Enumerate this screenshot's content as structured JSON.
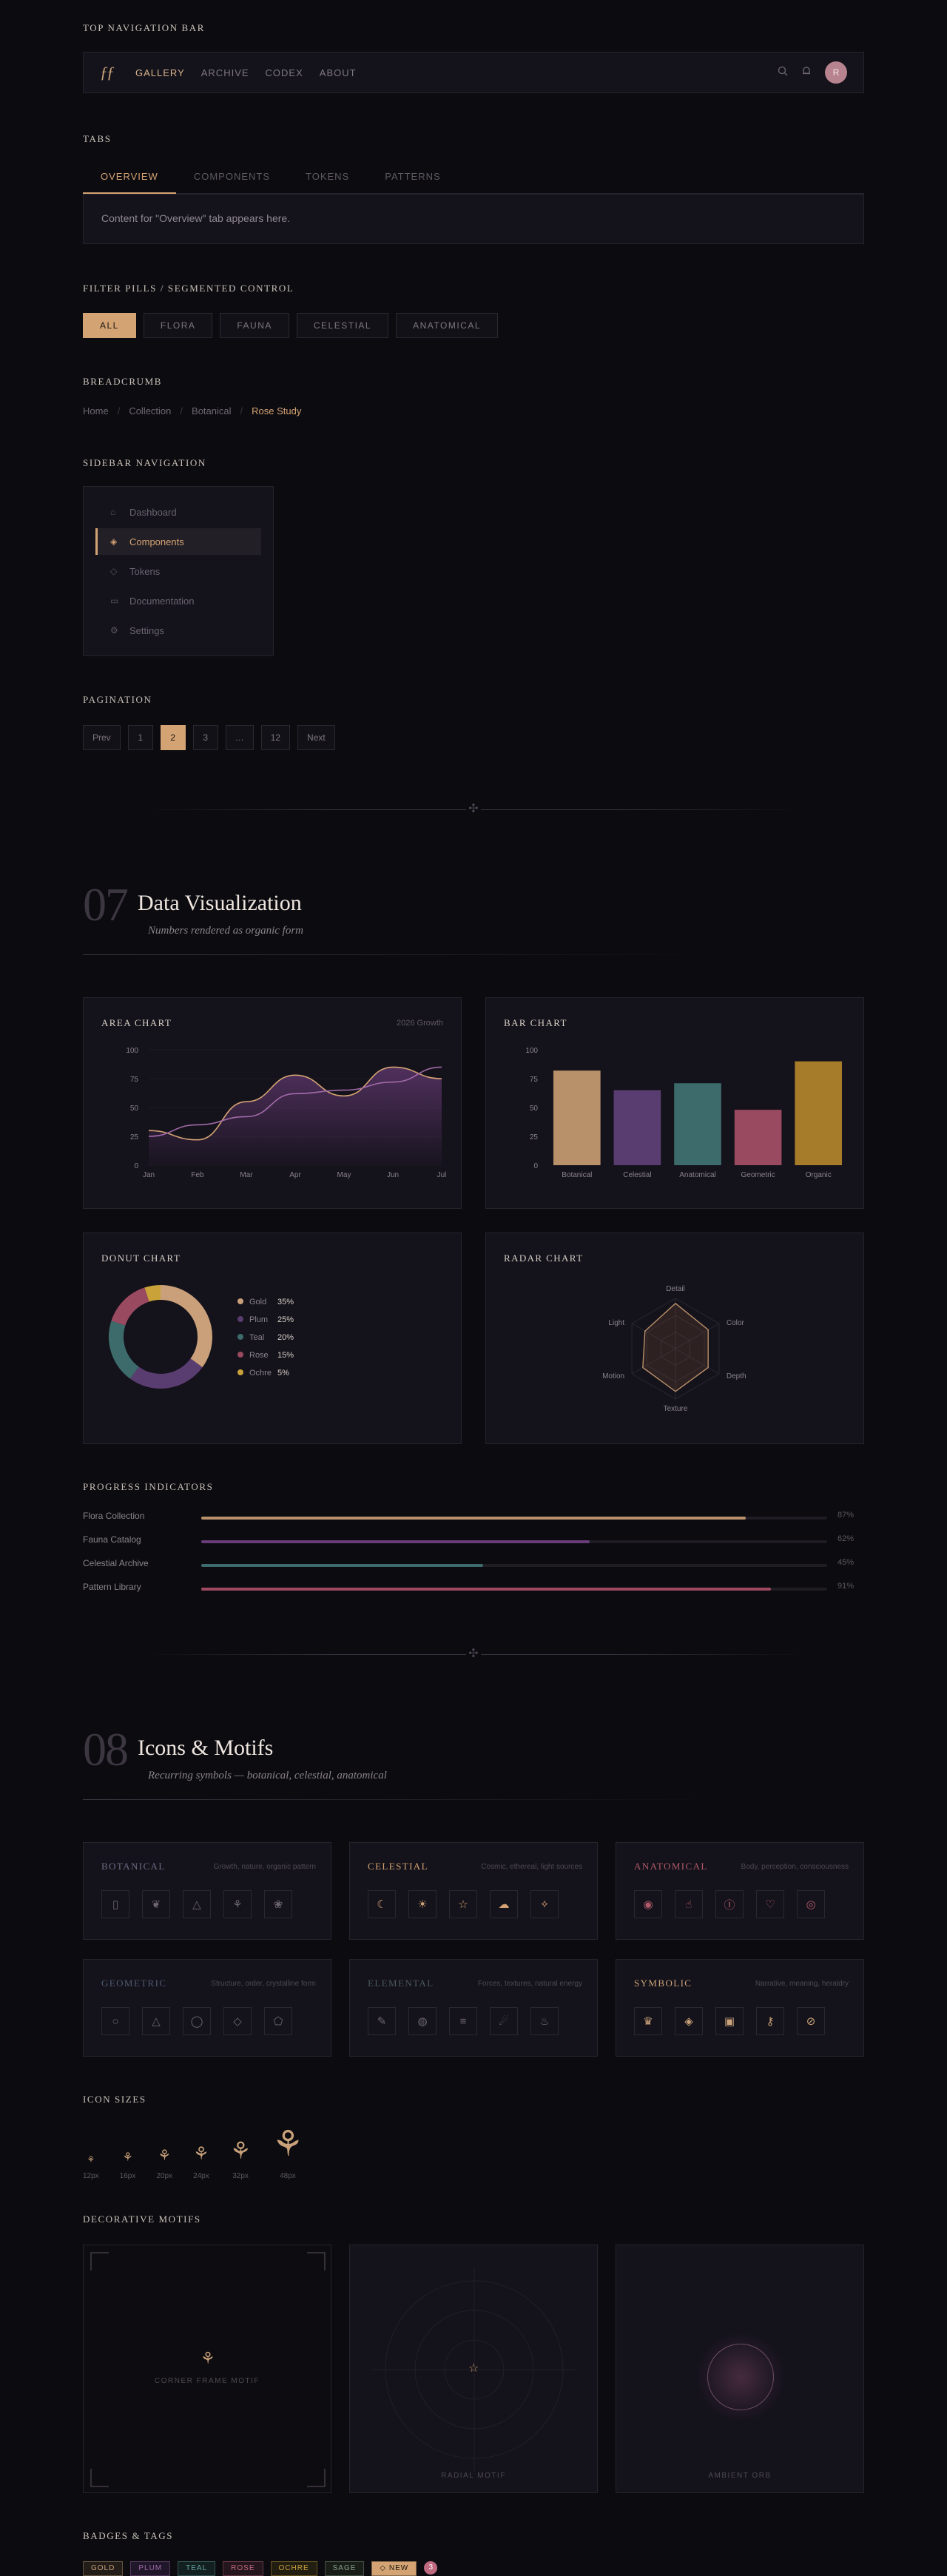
{
  "sections": {
    "top_nav": "TOP NAVIGATION BAR",
    "tabs": "TABS",
    "filter": "FILTER PILLS / SEGMENTED CONTROL",
    "breadcrumb": "BREADCRUMB",
    "sidebar": "SIDEBAR NAVIGATION",
    "pagination": "PAGINATION",
    "progress": "PROGRESS INDICATORS",
    "icon_sizes": "ICON SIZES",
    "motifs": "DECORATIVE MOTIFS",
    "badges": "BADGES & TAGS"
  },
  "nav": {
    "logo": "ƒƒ",
    "links": [
      "GALLERY",
      "ARCHIVE",
      "CODEX",
      "ABOUT"
    ],
    "avatar": "R"
  },
  "tabs": {
    "items": [
      "OVERVIEW",
      "COMPONENTS",
      "TOKENS",
      "PATTERNS"
    ],
    "content": "Content for \"Overview\" tab appears here."
  },
  "pills": [
    "ALL",
    "FLORA",
    "FAUNA",
    "CELESTIAL",
    "ANATOMICAL"
  ],
  "breadcrumb": [
    "Home",
    "Collection",
    "Botanical",
    "Rose Study"
  ],
  "sidebar": {
    "items": [
      {
        "label": "Dashboard",
        "icon": "⌂"
      },
      {
        "label": "Components",
        "icon": "◈"
      },
      {
        "label": "Tokens",
        "icon": "◇"
      },
      {
        "label": "Documentation",
        "icon": "▭"
      },
      {
        "label": "Settings",
        "icon": "⚙"
      }
    ]
  },
  "pagination": [
    "Prev",
    "1",
    "2",
    "3",
    "…",
    "12",
    "Next"
  ],
  "section07": {
    "num": "07",
    "title": "Data Visualization",
    "subtitle": "Numbers rendered as organic form"
  },
  "section08": {
    "num": "08",
    "title": "Icons & Motifs",
    "subtitle": "Recurring symbols — botanical, celestial, anatomical"
  },
  "cards": {
    "area_title": "AREA CHART",
    "area_note": "2026 Growth",
    "bar_title": "BAR CHART",
    "donut_title": "DONUT CHART",
    "radar_title": "RADAR CHART"
  },
  "chart_data": [
    {
      "type": "area",
      "title": "AREA CHART",
      "subtitle": "2026 Growth",
      "categories": [
        "Jan",
        "Feb",
        "Mar",
        "Apr",
        "May",
        "Jun",
        "Jul"
      ],
      "ylim": [
        0,
        100
      ],
      "yticks": [
        0,
        25,
        50,
        75,
        100
      ],
      "series": [
        {
          "color": "#d4a373",
          "values": [
            30,
            22,
            55,
            78,
            60,
            85,
            75
          ]
        },
        {
          "color": "#a06aa8",
          "values": [
            25,
            35,
            42,
            62,
            65,
            72,
            85
          ]
        }
      ]
    },
    {
      "type": "bar",
      "title": "BAR CHART",
      "categories": [
        "Botanical",
        "Celestial",
        "Anatomical",
        "Geometric",
        "Organic"
      ],
      "values": [
        82,
        65,
        71,
        48,
        90
      ],
      "colors": [
        "#b8906a",
        "#5a3d70",
        "#3d6b6b",
        "#9a4a60",
        "#a67c2a"
      ],
      "ylim": [
        0,
        100
      ],
      "yticks": [
        0,
        25,
        50,
        75,
        100
      ]
    },
    {
      "type": "pie",
      "title": "DONUT CHART",
      "labels": [
        "Gold",
        "Plum",
        "Teal",
        "Rose",
        "Ochre"
      ],
      "values": [
        35,
        25,
        20,
        15,
        5
      ],
      "colors": [
        "#c9a07a",
        "#5a3d70",
        "#3d6b6b",
        "#9a4a60",
        "#c9a23a"
      ]
    },
    {
      "type": "radar",
      "title": "RADAR CHART",
      "axes": [
        "Detail",
        "Color",
        "Depth",
        "Texture",
        "Motion",
        "Light"
      ],
      "values": [
        0.9,
        0.75,
        0.75,
        0.85,
        0.75,
        0.7
      ]
    }
  ],
  "progress": [
    {
      "label": "Flora Collection",
      "value": 87,
      "text": "87%",
      "color": "#b8906a"
    },
    {
      "label": "Fauna Catalog",
      "value": 62,
      "text": "62%",
      "color": "#6a3d7a"
    },
    {
      "label": "Celestial Archive",
      "value": 45,
      "text": "45%",
      "color": "#3d6b6b"
    },
    {
      "label": "Pattern Library",
      "value": 91,
      "text": "91%",
      "color": "#a04a62"
    }
  ],
  "icon_groups": [
    {
      "title": "BOTANICAL",
      "desc": "Growth, nature, organic pattern",
      "color": "#6f6a86",
      "icons": [
        "▯",
        "❦",
        "△",
        "⚘",
        "❀"
      ]
    },
    {
      "title": "CELESTIAL",
      "desc": "Cosmic, ethereal, light sources",
      "color": "#d4a373",
      "icons": [
        "☾",
        "☀",
        "☆",
        "☁",
        "✧"
      ]
    },
    {
      "title": "ANATOMICAL",
      "desc": "Body, perception, consciousness",
      "color": "#b05a6a",
      "icons": [
        "◉",
        "☝",
        "Ⓘ",
        "♡",
        "◎"
      ]
    },
    {
      "title": "GEOMETRIC",
      "desc": "Structure, order, crystalline form",
      "color": "#4e5a70",
      "icons": [
        "○",
        "△",
        "◯",
        "◇",
        "⬠"
      ]
    },
    {
      "title": "ELEMENTAL",
      "desc": "Forces, textures, natural energy",
      "color": "#4a5a5a",
      "icons": [
        "✎",
        "◍",
        "≡",
        "☄",
        "♨"
      ]
    },
    {
      "title": "SYMBOLIC",
      "desc": "Narrative, meaning, heraldry",
      "color": "#c9a27a",
      "icons": [
        "♛",
        "◈",
        "▣",
        "⚷",
        "⊘"
      ]
    }
  ],
  "icon_sizes": [
    "12px",
    "16px",
    "20px",
    "24px",
    "32px",
    "48px"
  ],
  "motifs": [
    "CORNER FRAME MOTIF",
    "RADIAL MOTIF",
    "AMBIENT ORB"
  ],
  "badges": [
    {
      "label": "GOLD",
      "color": "#c9a27a",
      "bg": "#221d18"
    },
    {
      "label": "PLUM",
      "color": "#a06aa8",
      "bg": "#20172a"
    },
    {
      "label": "TEAL",
      "color": "#6aa0a0",
      "bg": "#122020"
    },
    {
      "label": "ROSE",
      "color": "#c06a80",
      "bg": "#24161c"
    },
    {
      "label": "OCHRE",
      "color": "#c9a23a",
      "bg": "#231e12"
    },
    {
      "label": "SAGE",
      "color": "#8aa08a",
      "bg": "#181d18"
    },
    {
      "label": "◇ NEW",
      "color": "#1a1510",
      "bg": "#d4a373"
    }
  ],
  "badge_count": "3"
}
